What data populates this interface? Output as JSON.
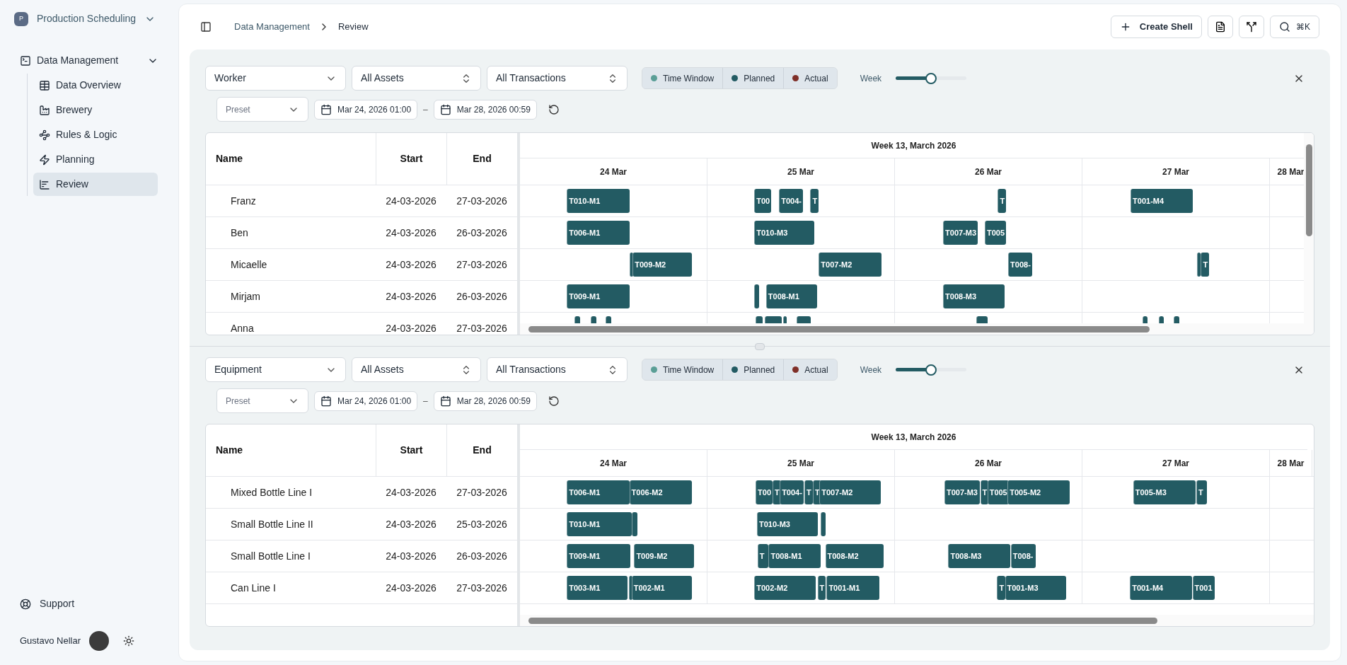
{
  "sidebar": {
    "workspace": {
      "initial": "P",
      "name": "Production Scheduling"
    },
    "section": {
      "label": "Data Management",
      "expanded": true,
      "items": [
        {
          "label": "Data Overview",
          "selected": false
        },
        {
          "label": "Brewery",
          "selected": false
        },
        {
          "label": "Rules & Logic",
          "selected": false
        },
        {
          "label": "Planning",
          "selected": false
        },
        {
          "label": "Review",
          "selected": true
        }
      ]
    },
    "support": "Support",
    "user": {
      "name": "Gustavo Nellar"
    }
  },
  "header": {
    "breadcrumb": [
      "Data Management",
      "Review"
    ],
    "create_button": "Create Shell",
    "search_shortcut": "⌘K"
  },
  "panels": [
    {
      "group_by": "Worker",
      "assets": "All Assets",
      "transactions": "All Transactions",
      "legend": [
        {
          "label": "Time Window",
          "color": "#5a9e96",
          "selected": true
        },
        {
          "label": "Planned",
          "color": "#235b63",
          "selected": true
        },
        {
          "label": "Actual",
          "color": "#7f2f28",
          "selected": true
        }
      ],
      "zoom": {
        "label": "Week",
        "level": 0.5
      },
      "preset": {
        "placeholder": "Preset"
      },
      "date_from": "Mar 24, 2026 01:00",
      "date_separator": "–",
      "date_to": "Mar 28, 2026 00:59",
      "columns": [
        "Name",
        "Start",
        "End"
      ],
      "timeline_title": "Week 13, March 2026",
      "days": [
        "24 Mar",
        "25 Mar",
        "26 Mar",
        "27 Mar",
        "28 Mar"
      ],
      "rows": [
        {
          "name": "Franz",
          "start": "24-03-2026",
          "end": "27-03-2026",
          "bars": [
            "T010-M1",
            "T00",
            "T004-",
            "T",
            "T",
            "T001-M4"
          ]
        },
        {
          "name": "Ben",
          "start": "24-03-2026",
          "end": "26-03-2026",
          "bars": [
            "T006-M1",
            "T010-M3",
            "T007-M3",
            "T005"
          ]
        },
        {
          "name": "Micaelle",
          "start": "24-03-2026",
          "end": "27-03-2026",
          "bars": [
            "T009-M2",
            "T007-M2",
            "T008-",
            "T"
          ]
        },
        {
          "name": "Mirjam",
          "start": "24-03-2026",
          "end": "26-03-2026",
          "bars": [
            "T009-M1",
            "T008-M1",
            "T008-M3"
          ]
        },
        {
          "name": "Anna",
          "start": "24-03-2026",
          "end": "27-03-2026"
        }
      ]
    },
    {
      "group_by": "Equipment",
      "assets": "All Assets",
      "transactions": "All Transactions",
      "legend": [
        {
          "label": "Time Window",
          "color": "#5a9e96",
          "selected": true
        },
        {
          "label": "Planned",
          "color": "#235b63",
          "selected": true
        },
        {
          "label": "Actual",
          "color": "#7f2f28",
          "selected": true
        }
      ],
      "zoom": {
        "label": "Week",
        "level": 0.5
      },
      "preset": {
        "placeholder": "Preset"
      },
      "date_from": "Mar 24, 2026 01:00",
      "date_separator": "–",
      "date_to": "Mar 28, 2026 00:59",
      "columns": [
        "Name",
        "Start",
        "End"
      ],
      "timeline_title": "Week 13, March 2026",
      "days": [
        "24 Mar",
        "25 Mar",
        "26 Mar",
        "27 Mar",
        "28 Mar"
      ],
      "rows": [
        {
          "name": "Mixed Bottle Line I",
          "start": "24-03-2026",
          "end": "27-03-2026",
          "bars": [
            "T006-M1",
            "T006-M2",
            "T00",
            "T",
            "T004-",
            "T",
            "T",
            "T007-M2",
            "T007-M3",
            "T",
            "T005",
            "T005-M2",
            "T005-M3",
            "T"
          ]
        },
        {
          "name": "Small Bottle Line II",
          "start": "24-03-2026",
          "end": "25-03-2026",
          "bars": [
            "T010-M1",
            "T010-M3"
          ]
        },
        {
          "name": "Small Bottle Line I",
          "start": "24-03-2026",
          "end": "26-03-2026",
          "bars": [
            "T009-M1",
            "T009-M2",
            "T",
            "T008-M1",
            "T008-M2",
            "T008-M3",
            "T008-"
          ]
        },
        {
          "name": "Can Line I",
          "start": "24-03-2026",
          "end": "27-03-2026",
          "bars": [
            "T003-M1",
            "T002-M1",
            "T002-M2",
            "T",
            "T001-M1",
            "T",
            "T001-M3",
            "T001-M4",
            "T001"
          ]
        }
      ]
    }
  ]
}
